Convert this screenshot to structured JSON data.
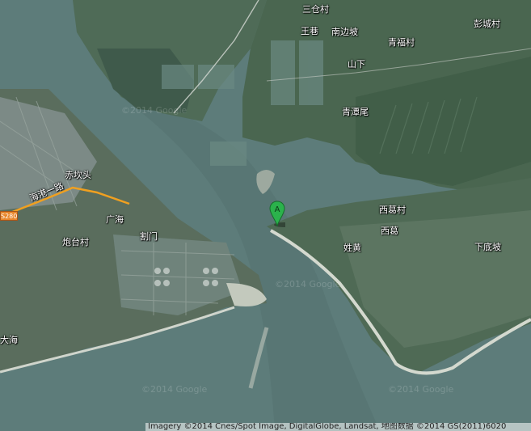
{
  "map": {
    "labels": [
      {
        "id": "sancangcun",
        "text": "三仓村"
      },
      {
        "id": "wangxiang",
        "text": "王巷"
      },
      {
        "id": "nanbianpo",
        "text": "南边坡"
      },
      {
        "id": "qingfucun",
        "text": "青福村"
      },
      {
        "id": "pengchengcun",
        "text": "彭城村"
      },
      {
        "id": "shanxia",
        "text": "山下"
      },
      {
        "id": "qingtanwei",
        "text": "青潭尾"
      },
      {
        "id": "chikantou",
        "text": "赤坎头"
      },
      {
        "id": "haigangyilu",
        "text": "海港一路"
      },
      {
        "id": "guanghai",
        "text": "广海"
      },
      {
        "id": "paotaicun",
        "text": "炮台村"
      },
      {
        "id": "gemen",
        "text": "割门"
      },
      {
        "id": "xigecun",
        "text": "西葛村"
      },
      {
        "id": "xige",
        "text": "西葛"
      },
      {
        "id": "xingshuang",
        "text": "姓黄"
      },
      {
        "id": "xiadipo",
        "text": "下底坡"
      },
      {
        "id": "dahai",
        "text": "大海"
      }
    ],
    "road_shield": "S280",
    "marker": {
      "letter": "A",
      "color": "#2bb24c"
    },
    "watermark": "©2014 Google",
    "attribution": "Imagery ©2014 Cnes/Spot Image, DigitalGlobe, Landsat, 地图数据 ©2014 GS(2011)6020"
  }
}
